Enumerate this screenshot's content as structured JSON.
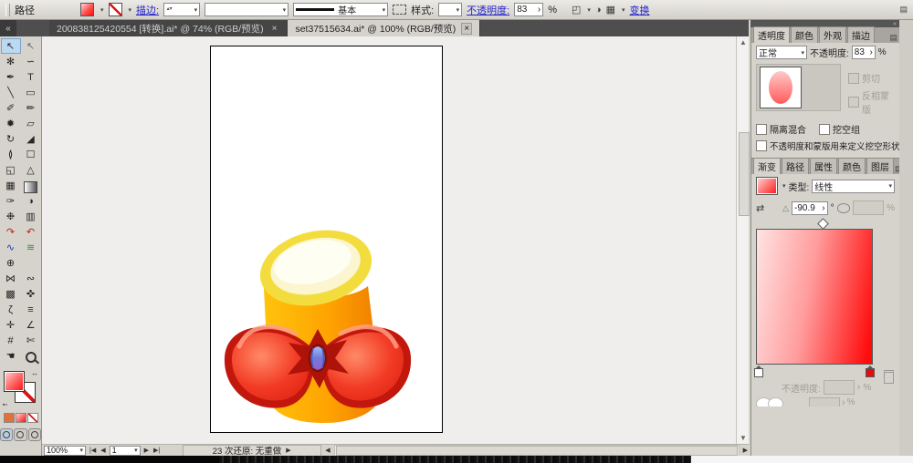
{
  "icons": {
    "panel_menu": "▤",
    "collapse_left": "«",
    "collapse_right": "«",
    "dropdown": "▾",
    "spinner_up_down": "▴▾",
    "spinner_right": "›",
    "swap_arrows": "↔",
    "default_swatches": "▪▫",
    "angle": "△",
    "reverse_gradient": "⇄",
    "vscroll_up": "▲",
    "vscroll_down": "▼",
    "nav_first": "|◀",
    "nav_prev": "◀",
    "nav_next": "▶",
    "nav_last": "▶|",
    "undo_expand": "▶",
    "hscroll_left": "◀",
    "hscroll_right": "▶",
    "isolate": "◰",
    "recolor": "◑",
    "doc_grid": "▦"
  },
  "control_bar": {
    "context_label": "路径",
    "stroke_link": "描边:",
    "line_style_value": "基本",
    "style_label": "样式:",
    "opacity_link": "不透明度:",
    "opacity_value": "83",
    "percent_label": "%",
    "transform_link": "变换"
  },
  "document_tabs": [
    {
      "label": "200838125420554 [转换].ai* @ 74% (RGB/预览)",
      "close": "×",
      "active": false
    },
    {
      "label": "set37515634.ai* @ 100% (RGB/预览)",
      "close": "×",
      "active": true
    }
  ],
  "toolbox": {
    "tools": [
      {
        "name": "selection-tool",
        "glyph": "↖",
        "active": true
      },
      {
        "name": "direct-selection-tool",
        "glyph": "↖",
        "color": "#6b6b6b"
      },
      {
        "name": "magic-wand-tool",
        "glyph": "✻"
      },
      {
        "name": "lasso-tool",
        "glyph": "∽"
      },
      {
        "name": "pen-tool",
        "glyph": "✒"
      },
      {
        "name": "type-tool",
        "glyph": "T"
      },
      {
        "name": "line-segment-tool",
        "glyph": "╲"
      },
      {
        "name": "rectangle-tool",
        "glyph": "▭"
      },
      {
        "name": "paintbrush-tool",
        "glyph": "✐"
      },
      {
        "name": "pencil-tool",
        "glyph": "✏"
      },
      {
        "name": "blob-brush-tool",
        "glyph": "✹"
      },
      {
        "name": "eraser-tool",
        "glyph": "▱"
      },
      {
        "name": "rotate-tool",
        "glyph": "↻"
      },
      {
        "name": "scale-tool",
        "glyph": "◢"
      },
      {
        "name": "width-tool",
        "glyph": "≬"
      },
      {
        "name": "free-transform-tool",
        "glyph": "☐"
      },
      {
        "name": "shape-builder-tool",
        "glyph": "◱"
      },
      {
        "name": "perspective-grid-tool",
        "glyph": "△"
      },
      {
        "name": "mesh-tool",
        "glyph": "▦"
      },
      {
        "name": "gradient-tool",
        "cls": "grad-sw"
      },
      {
        "name": "eyedropper-tool",
        "glyph": "✑"
      },
      {
        "name": "blend-tool",
        "glyph": "◑"
      },
      {
        "name": "symbol-sprayer-tool",
        "glyph": "❉"
      },
      {
        "name": "column-graph-tool",
        "glyph": "▥"
      },
      {
        "name": "arc-tool",
        "glyph": "↷",
        "color": "#bb2211"
      },
      {
        "name": "spiral-tool",
        "glyph": "↶",
        "color": "#bb2211"
      },
      {
        "name": "polyline-tool",
        "glyph": "∿",
        "color": "#2233bb"
      },
      {
        "name": "wave-tool",
        "glyph": "≋",
        "color": "#3a8a3a"
      },
      {
        "name": "rotate-view-tool",
        "glyph": "⊕"
      },
      {
        "name": "blank",
        "glyph": ""
      },
      {
        "name": "warp-tool",
        "glyph": "⋈"
      },
      {
        "name": "wrinkle-tool",
        "glyph": "∾"
      },
      {
        "name": "lattice-tool",
        "glyph": "▩"
      },
      {
        "name": "pucker-tool",
        "glyph": "✜"
      },
      {
        "name": "scribble-tool",
        "glyph": "ζ"
      },
      {
        "name": "align-tool",
        "glyph": "≡"
      },
      {
        "name": "measure-tool",
        "glyph": "✛"
      },
      {
        "name": "angle-tool",
        "glyph": "∠"
      },
      {
        "name": "crop-tool",
        "glyph": "#"
      },
      {
        "name": "slice-tool",
        "glyph": "✄"
      },
      {
        "name": "hand-tool",
        "glyph": "☚"
      },
      {
        "name": "zoom-tool",
        "cls": "zoom-glyph"
      }
    ]
  },
  "transparency_panel": {
    "tabs": [
      {
        "label": "透明度",
        "active": true
      },
      {
        "label": "颜色",
        "active": false
      },
      {
        "label": "外观",
        "active": false
      },
      {
        "label": "描边",
        "active": false
      }
    ],
    "blend_mode_value": "正常",
    "opacity_label": "不透明度:",
    "opacity_value": "83",
    "percent_label": "%",
    "clip_label": "剪切",
    "invert_mask_label": "反相蒙版",
    "isolate_blend_label": "隔离混合",
    "knockout_group_label": "挖空组",
    "knockout_shape_label": "不透明度和蒙版用来定义挖空形状"
  },
  "gradient_panel": {
    "tabs": [
      {
        "label": "渐变",
        "active": true
      },
      {
        "label": "路径",
        "active": false
      },
      {
        "label": "属性",
        "active": false
      },
      {
        "label": "颜色",
        "active": false
      },
      {
        "label": "图层",
        "active": false
      }
    ],
    "type_label": "类型:",
    "type_value": "线性",
    "angle_value": "-90.9",
    "degree_label": "°",
    "percent_label": "%",
    "opacity_label": "不透明度:",
    "colors": {
      "gradient_start": "#ffe3e3",
      "gradient_end": "#ff0c0c"
    }
  },
  "statusbar": {
    "zoom_value": "100%",
    "page_value": "1",
    "undo_status": "23 次还原: 无重做"
  },
  "artwork": {
    "description": "orange cylinder pen holder with yellow rim, cream opening and red bow with blue gem",
    "colors": {
      "body_light": "#ffc40d",
      "body_dark": "#ef7d00",
      "rim": "#f3dd3e",
      "rim_inner": "#fbf5d0",
      "bow_dark": "#c2170c",
      "bow_main": "#f23a24",
      "gem": "#6c7bdb"
    }
  }
}
